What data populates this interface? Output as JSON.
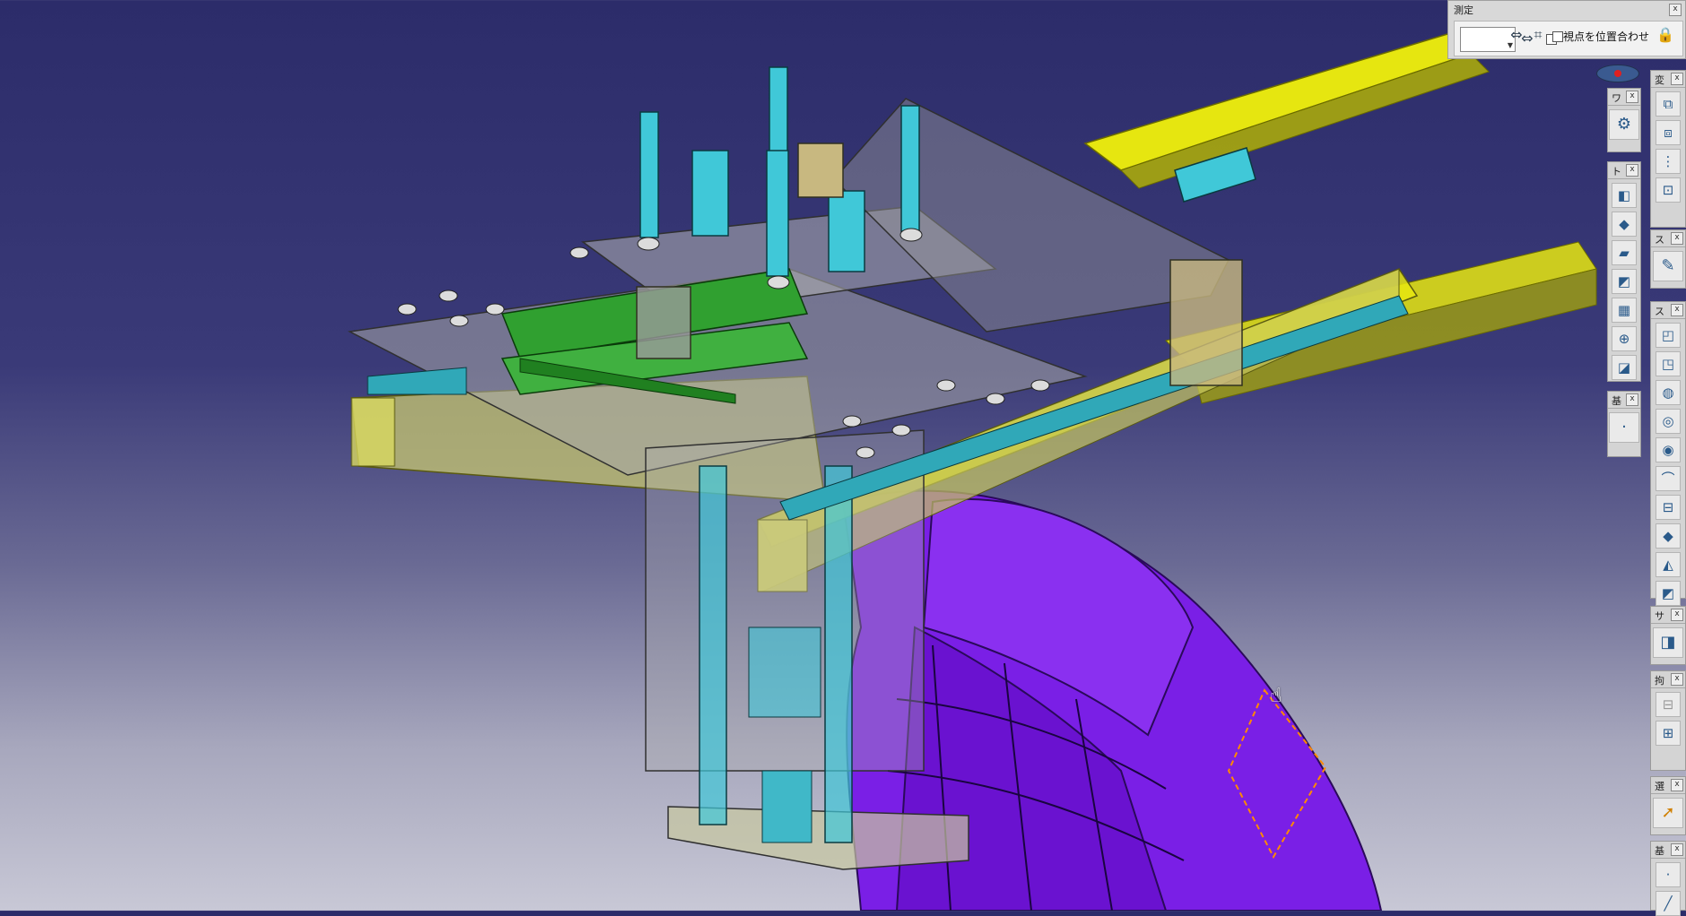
{
  "measure_toolbar": {
    "title": "測定",
    "close": "x",
    "align_view_label": "視点を位置合わせ",
    "icons": [
      "measure-distance-icon",
      "measure-item-icon",
      "lock-icon"
    ]
  },
  "toolbars": [
    {
      "name": "ワ",
      "close": "x",
      "icons": [
        "gear-icon"
      ]
    },
    {
      "name": "ト",
      "close": "x",
      "icons": [
        "pad-icon",
        "cube-icon",
        "solid-icon",
        "face-icon",
        "grid-icon",
        "target-icon",
        "shell-icon"
      ]
    },
    {
      "name": "基",
      "close": "x",
      "icons": [
        "point-icon"
      ]
    },
    {
      "name": "変",
      "close": "x",
      "icons": [
        "view-icon-1",
        "view-icon-2",
        "grid-icon",
        "fit-icon"
      ]
    },
    {
      "name": "ス",
      "close": "x",
      "icons": [
        "sketch-icon"
      ]
    },
    {
      "name": "ス",
      "close": "x",
      "icons": [
        "extrude-icon",
        "pocket-icon",
        "shaft-icon",
        "groove-icon",
        "hole-icon",
        "rib-icon",
        "slot-icon",
        "loft-icon",
        "draft-icon",
        "fillet-icon"
      ]
    },
    {
      "name": "サ",
      "close": "x",
      "icons": [
        "surface-icon"
      ]
    },
    {
      "name": "拘",
      "close": "x",
      "icons": [
        "constraint-icon",
        "constraint-icon-2"
      ]
    },
    {
      "name": "選",
      "close": "x",
      "icons": [
        "select-cursor-icon"
      ]
    },
    {
      "name": "基",
      "close": "x",
      "icons": [
        "point-icon",
        "line-icon"
      ]
    }
  ]
}
